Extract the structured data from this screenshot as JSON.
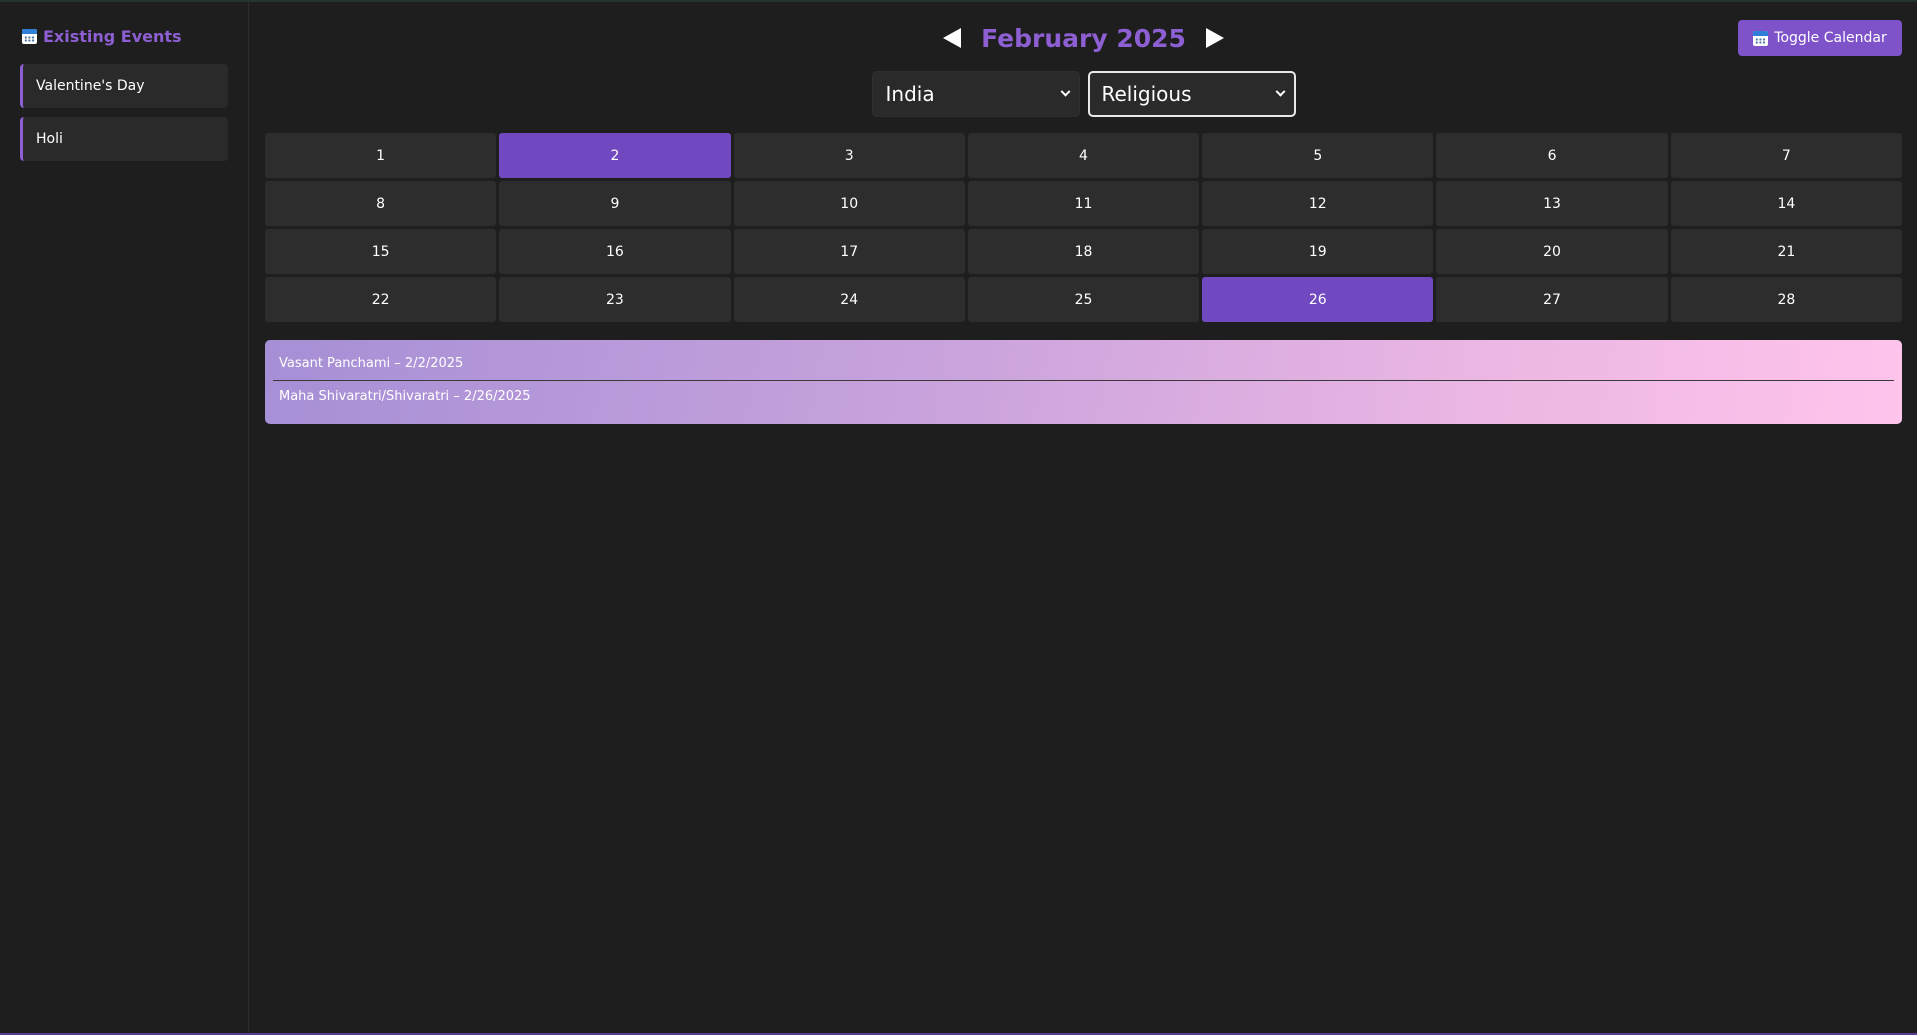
{
  "sidebar": {
    "title": "Existing Events",
    "title_icon": "calendar-icon",
    "events": [
      {
        "label": "Valentine's Day"
      },
      {
        "label": "Holi"
      }
    ]
  },
  "header": {
    "month_label": "February 2025",
    "toggle_label": "Toggle Calendar",
    "toggle_icon": "calendar-icon"
  },
  "filters": {
    "country": "India",
    "category": "Religious"
  },
  "calendar": {
    "days": [
      "1",
      "2",
      "3",
      "4",
      "5",
      "6",
      "7",
      "8",
      "9",
      "10",
      "11",
      "12",
      "13",
      "14",
      "15",
      "16",
      "17",
      "18",
      "19",
      "20",
      "21",
      "22",
      "23",
      "24",
      "25",
      "26",
      "27",
      "28"
    ],
    "highlighted_days": [
      "2",
      "26"
    ]
  },
  "holidays": [
    {
      "text": "Vasant Panchami – 2/2/2025"
    },
    {
      "text": "Maha Shivaratri/Shivaratri – 2/26/2025"
    }
  ],
  "colors": {
    "accent": "#8d5fd3",
    "highlight": "#7048bf",
    "background": "#1e1e1e",
    "cell": "#2d2d2d"
  }
}
